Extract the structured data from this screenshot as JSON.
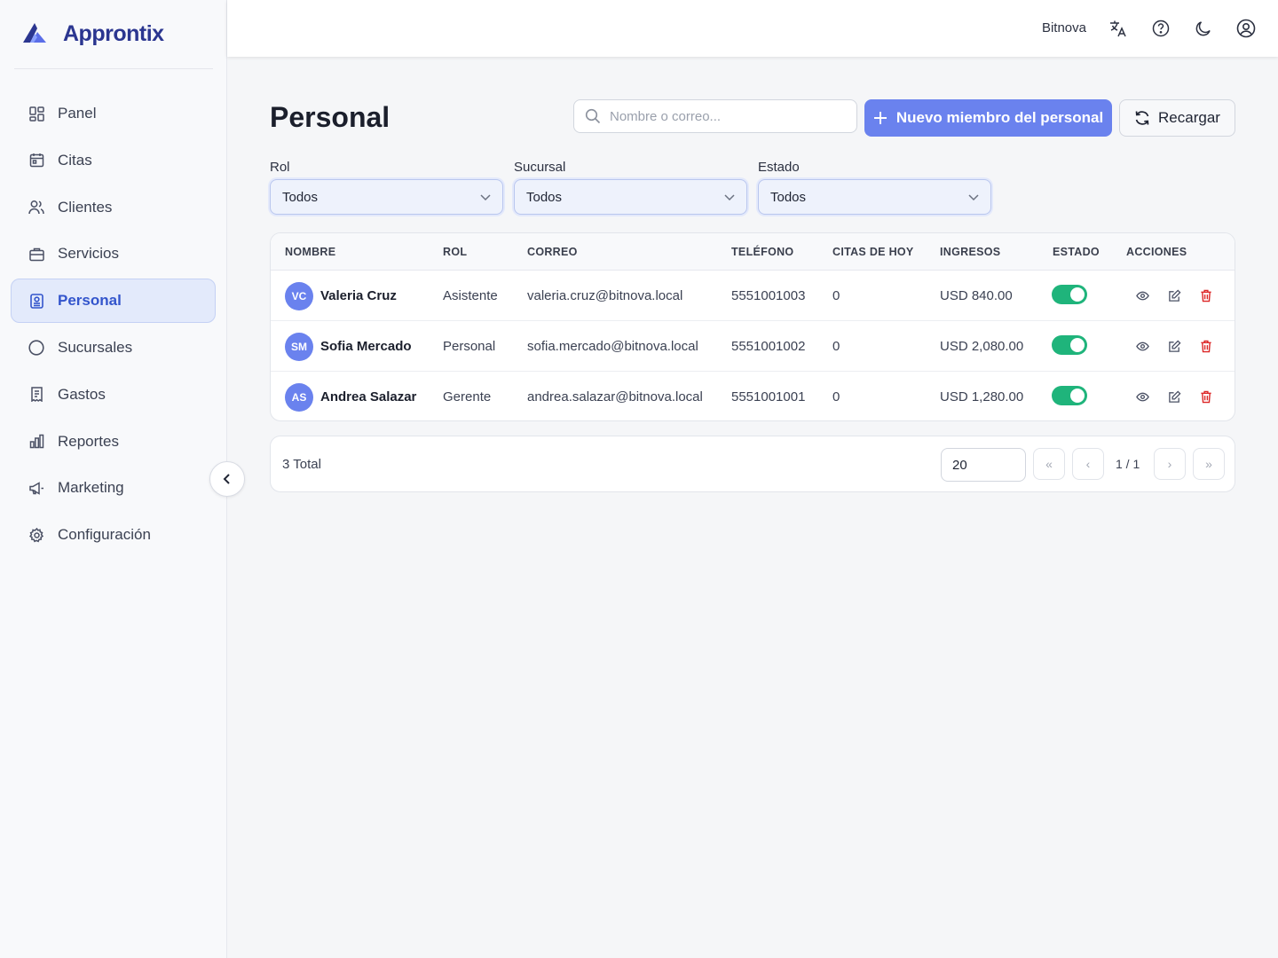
{
  "brand": {
    "name": "Approntix"
  },
  "sidebar": {
    "items": [
      {
        "label": "Panel",
        "icon": "dashboard-icon"
      },
      {
        "label": "Citas",
        "icon": "calendar-icon"
      },
      {
        "label": "Clientes",
        "icon": "users-icon"
      },
      {
        "label": "Servicios",
        "icon": "briefcase-icon"
      },
      {
        "label": "Personal",
        "icon": "badge-icon",
        "active": true
      },
      {
        "label": "Sucursales",
        "icon": "circle-icon"
      },
      {
        "label": "Gastos",
        "icon": "receipt-icon"
      },
      {
        "label": "Reportes",
        "icon": "bar-chart-icon"
      },
      {
        "label": "Marketing",
        "icon": "megaphone-icon"
      },
      {
        "label": "Configuración",
        "icon": "gear-icon"
      }
    ]
  },
  "header": {
    "tenant": "Bitnova"
  },
  "page": {
    "title": "Personal",
    "search_placeholder": "Nombre o correo...",
    "new_button": "Nuevo miembro del personal",
    "reload_button": "Recargar"
  },
  "filters": [
    {
      "label": "Rol",
      "value": "Todos"
    },
    {
      "label": "Sucursal",
      "value": "Todos"
    },
    {
      "label": "Estado",
      "value": "Todos"
    }
  ],
  "table": {
    "columns": [
      "NOMBRE",
      "ROL",
      "CORREO",
      "TELÉFONO",
      "CITAS DE HOY",
      "INGRESOS",
      "ESTADO",
      "ACCIONES"
    ],
    "rows": [
      {
        "initials": "VC",
        "name": "Valeria Cruz",
        "role": "Asistente",
        "email": "valeria.cruz@bitnova.local",
        "phone": "5551001003",
        "today": "0",
        "income": "USD 840.00",
        "active": true
      },
      {
        "initials": "SM",
        "name": "Sofia Mercado",
        "role": "Personal",
        "email": "sofia.mercado@bitnova.local",
        "phone": "5551001002",
        "today": "0",
        "income": "USD 2,080.00",
        "active": true
      },
      {
        "initials": "AS",
        "name": "Andrea Salazar",
        "role": "Gerente",
        "email": "andrea.salazar@bitnova.local",
        "phone": "5551001001",
        "today": "0",
        "income": "USD 1,280.00",
        "active": true
      }
    ]
  },
  "pagination": {
    "total": "3 Total",
    "page_size": "20",
    "info": "1 / 1",
    "first": "«",
    "prev": "‹",
    "next": "›",
    "last": "»"
  },
  "colors": {
    "primary": "#6a82ee",
    "active_nav": "#3355cc",
    "toggle_on": "#1fb47b",
    "danger": "#dc2626"
  }
}
